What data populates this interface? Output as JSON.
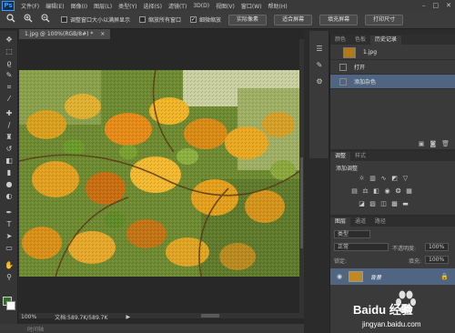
{
  "app": {
    "logo": "Ps"
  },
  "menu": [
    "文件(F)",
    "编辑(E)",
    "图像(I)",
    "图层(L)",
    "类型(Y)",
    "选择(S)",
    "滤镜(T)",
    "3D(D)",
    "视图(V)",
    "窗口(W)",
    "帮助(H)"
  ],
  "window_controls": {
    "minimize": "–",
    "restore": "□",
    "close": "✕"
  },
  "options": {
    "resize_windows": "调整窗口大小以满屏显示",
    "zoom_all": "缩放所有窗口",
    "scrubby_zoom": "细微缩放",
    "scrubby_checked": "✓",
    "btn_actual_pixels": "实际像素",
    "btn_fit_screen": "适合屏幕",
    "btn_fill_screen": "填充屏幕",
    "btn_print_size": "打印尺寸"
  },
  "document": {
    "tab_title": "1.jpg @ 100%(RGB/8#) *",
    "tab_close": "×",
    "zoom": "100%",
    "doc_info": "文档:589.7K/589.7K",
    "scroll_arrow": "▶"
  },
  "bottom_panel": {
    "label": "时间轴"
  },
  "history_panel": {
    "tabs": [
      "颜色",
      "色板",
      "历史记录"
    ],
    "active_tab": 2,
    "snapshot_label": "1.jpg",
    "steps": [
      "打开",
      "添加杂色"
    ],
    "selected_step": 1
  },
  "adjustments_panel": {
    "tabs": [
      "调整",
      "样式"
    ],
    "active_tab": 0,
    "title": "添加调整"
  },
  "layers_panel": {
    "tabs": [
      "图层",
      "通道",
      "路径"
    ],
    "active_tab": 0,
    "kind_filter": "类型",
    "blend_mode": "正常",
    "opacity_label": "不透明度:",
    "opacity_value": "100%",
    "lock_label": "锁定:",
    "fill_label": "填充:",
    "fill_value": "100%",
    "layer_name": "背景"
  },
  "watermark": {
    "brand": "Baidu 经验",
    "url": "jingyan.baidu.com"
  },
  "colors": {
    "foreground": "#2f6e2c",
    "background": "#ffffff",
    "selection": "#4f6582"
  },
  "icons": {
    "toolbox": [
      "move-icon",
      "marquee-icon",
      "lasso-icon",
      "quick-select-icon",
      "crop-icon",
      "eyedropper-icon",
      "healing-brush-icon",
      "brush-icon",
      "clone-stamp-icon",
      "history-brush-icon",
      "eraser-icon",
      "gradient-icon",
      "blur-icon",
      "dodge-icon",
      "pen-icon",
      "type-icon",
      "path-select-icon",
      "shape-icon",
      "hand-icon",
      "zoom-icon"
    ]
  }
}
